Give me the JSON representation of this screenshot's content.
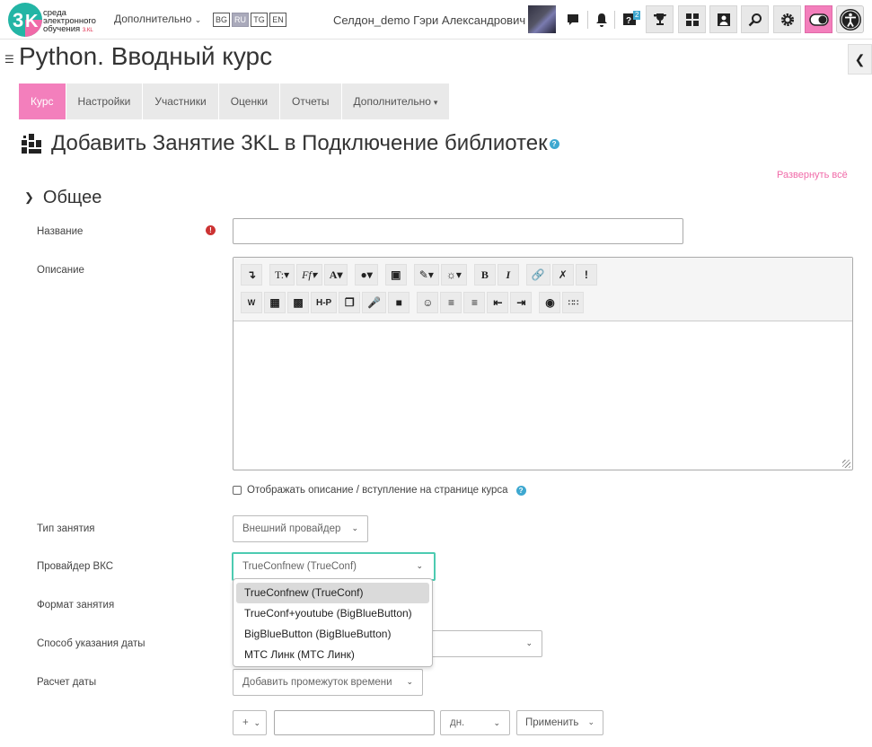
{
  "navbar": {
    "logo_line1": "среда",
    "logo_line2": "электронного",
    "logo_line3": "обучения",
    "logo_small": "3.КL",
    "more_label": "Дополнительно",
    "languages": [
      {
        "code": "BG",
        "active": false
      },
      {
        "code": "RU",
        "active": true
      },
      {
        "code": "TG",
        "active": false
      },
      {
        "code": "EN",
        "active": false
      }
    ],
    "user_name": "Селдон_demo Гэри Александрович",
    "badge_count": "2",
    "pink_color": "#f37fbc",
    "teal_color": "#4ccbb1",
    "link_color": "#f06aa8"
  },
  "page": {
    "course_title": "Python. Вводный курс",
    "heading": "Добавить Занятие 3KL в Подключение библиотек",
    "expand_all": "Развернуть всё"
  },
  "tabs": [
    {
      "label": "Курс",
      "active": true
    },
    {
      "label": "Настройки",
      "active": false
    },
    {
      "label": "Участники",
      "active": false
    },
    {
      "label": "Оценки",
      "active": false
    },
    {
      "label": "Отчеты",
      "active": false
    },
    {
      "label": "Дополнительно",
      "active": false
    }
  ],
  "form": {
    "section_title": "Общее",
    "name_label": "Название",
    "name_value": "",
    "description_label": "Описание",
    "show_description_label": "Отображать описание / вступление на странице курса",
    "lesson_type_label": "Тип занятия",
    "lesson_type_value": "Внешний провайдер",
    "provider_label": "Провайдер ВКС",
    "provider_value": "TrueConfnew (TrueConf)",
    "provider_options": [
      {
        "label": "TrueConfnew (TrueConf)",
        "selected": true
      },
      {
        "label": "TrueConf+youtube (BigBlueButton)",
        "selected": false
      },
      {
        "label": "BigBlueButton (BigBlueButton)",
        "selected": false
      },
      {
        "label": "МТС Линк (МТС Линк)",
        "selected": false
      }
    ],
    "format_label": "Формат занятия",
    "date_method_label": "Способ указания даты",
    "date_calc_label": "Расчет даты",
    "add_interval_value": "Добавить промежуток времени",
    "sign_value": "+",
    "interval_value": "",
    "unit_value": "дн.",
    "apply_label": "Применить"
  },
  "editor": {
    "row1": [
      "↴",
      "T:▾",
      "Ff▾",
      "A▾",
      "◆▾",
      "cube",
      "brush▾",
      "bulb▾",
      "B",
      "I",
      "link",
      "unlink",
      "!"
    ],
    "row2": [
      "word",
      "image",
      "media",
      "H-P",
      "copy",
      "mic",
      "video",
      "smile",
      "ul",
      "ol",
      "outdent",
      "indent",
      "a11y",
      "grid"
    ]
  }
}
